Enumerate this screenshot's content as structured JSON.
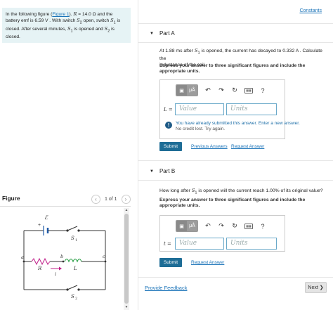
{
  "problem": {
    "before_link": "In the following figure (",
    "link": "Figure 1",
    "after_link": "). ",
    "r_var": "R",
    "r_value": " = 14.0 Ω and the",
    "line2_a": "battery emf is 6.59 V . With switch ",
    "s2": "S",
    "s2_sub": "2",
    "line2_b": " open, switch ",
    "s1": "S",
    "s1_sub": "1",
    "line2_c": " is",
    "line3_a": "closed. After several minutes, ",
    "line3_b": " is opened and ",
    "line3_c": " is",
    "line4": "closed."
  },
  "figure": {
    "label": "Figure",
    "pager_text": "1 of 1",
    "prev_icon": "chevron-left-icon",
    "next_icon": "chevron-right-icon",
    "labels": {
      "emf": "ℰ",
      "plus": "+",
      "s1": "S",
      "s1_sub": "1",
      "s2": "S",
      "s2_sub": "2",
      "a": "a",
      "b": "b",
      "c": "c",
      "r": "R",
      "l": "L",
      "i": "i"
    }
  },
  "header": {
    "constants": "Constants"
  },
  "part_a": {
    "title": "Part A",
    "q_a": "At 1.88 ms after ",
    "q_s": "S",
    "q_sub": "1",
    "q_b": " is opened, the current has decayed to 0.332 A . Calculate the",
    "q_line2": "inductance of the coil.",
    "instruction": "Express your answer to three significant figures and include the appropriate units.",
    "var_label": "L =",
    "value_placeholder": "Value",
    "units_placeholder": "Units",
    "notice_main": "You have already submitted this answer. Enter a new answer.",
    "notice_sub": "No credit lost. Try again.",
    "submit": "Submit",
    "previous_answers": "Previous Answers",
    "request_answer": "Request Answer"
  },
  "part_b": {
    "title": "Part B",
    "q_a": "How long after ",
    "q_s": "S",
    "q_sub": "1",
    "q_b": " is opened will the current reach 1.00% of its original value?",
    "instruction": "Express your answer to three significant figures and include the appropriate units.",
    "var_label": "t =",
    "value_placeholder": "Value",
    "units_placeholder": "Units",
    "submit": "Submit",
    "request_answer": "Request Answer"
  },
  "toolbar": {
    "template_icon": "template-icon",
    "units_label": "μÅ",
    "undo_icon": "undo-icon",
    "redo_icon": "redo-icon",
    "reset_icon": "reset-icon",
    "keyboard_icon": "keyboard-icon",
    "help_label": "?"
  },
  "footer": {
    "feedback": "Provide Feedback",
    "next": "Next ❯"
  },
  "colors": {
    "problem_bg": "#e6f3f5",
    "link": "#1a73b8",
    "submit_bg": "#1e6d96",
    "inductor": "#1e9a3c",
    "current_arrow": "#c0208a",
    "battery": "#1e5aa8"
  }
}
